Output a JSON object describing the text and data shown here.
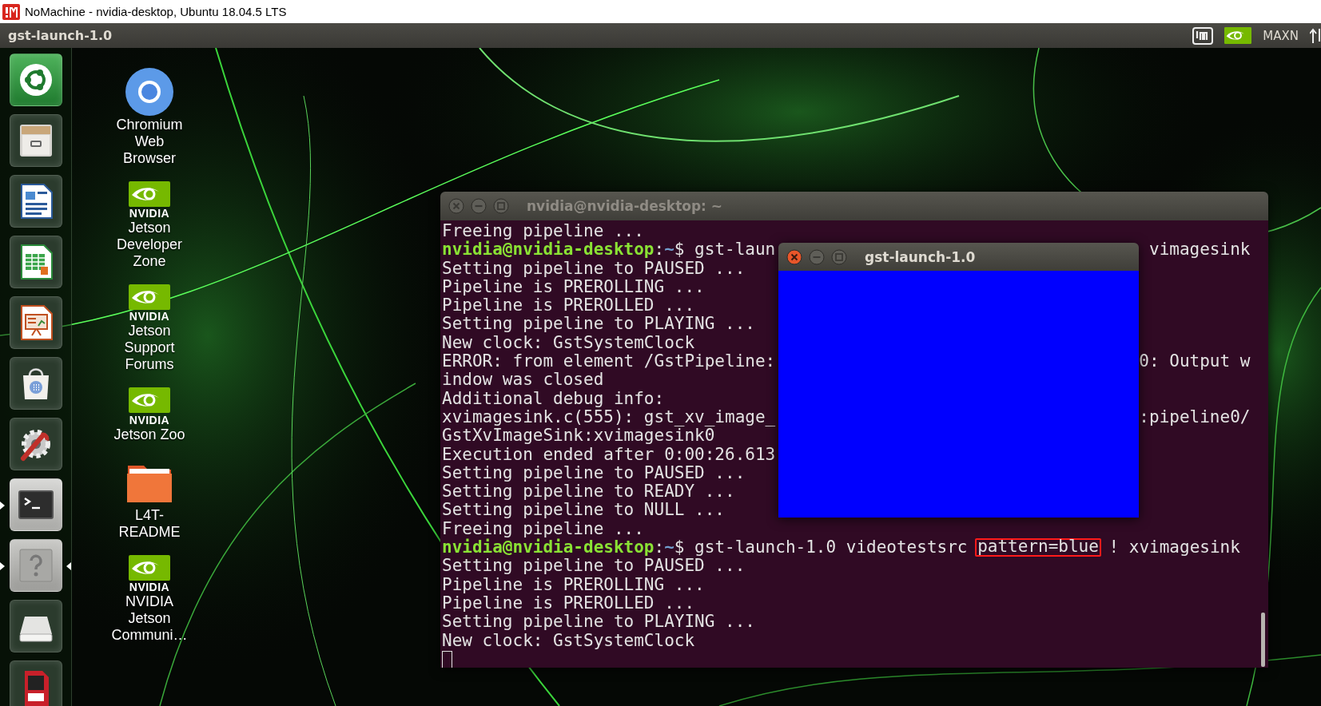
{
  "host_window": {
    "title": "NoMachine - nvidia-desktop, Ubuntu 18.04.5 LTS"
  },
  "top_panel": {
    "app_title": "gst-launch-1.0",
    "power_mode": "MAXN"
  },
  "launcher": {
    "items": [
      {
        "running": false,
        "focused": false
      },
      {
        "running": false,
        "focused": false
      },
      {
        "running": false,
        "focused": false
      },
      {
        "running": false,
        "focused": false
      },
      {
        "running": false,
        "focused": false
      },
      {
        "running": false,
        "focused": false
      },
      {
        "running": false,
        "focused": false
      },
      {
        "running": true,
        "focused": false
      },
      {
        "running": true,
        "focused": true
      },
      {
        "running": false,
        "focused": false
      },
      {
        "running": false,
        "focused": false
      }
    ]
  },
  "desktop_icons": [
    {
      "kind": "chromium",
      "label": "Chromium Web Browser"
    },
    {
      "kind": "nvidia",
      "wordmark": "NVIDIA",
      "label": "Jetson Developer Zone"
    },
    {
      "kind": "nvidia",
      "wordmark": "NVIDIA",
      "label": "Jetson Support Forums"
    },
    {
      "kind": "nvidia",
      "wordmark": "NVIDIA",
      "label": "Jetson Zoo"
    },
    {
      "kind": "folder",
      "label": "L4T-README"
    },
    {
      "kind": "nvidia",
      "wordmark": "NVIDIA",
      "label": "NVIDIA Jetson Communi…"
    }
  ],
  "terminal": {
    "title": "nvidia@nvidia-desktop: ~",
    "active": false,
    "lines": [
      {
        "kind": "text",
        "text": "Freeing pipeline ..."
      },
      {
        "kind": "command",
        "segments": [
          {
            "kind": "user",
            "text": "nvidia@nvidia-desktop"
          },
          {
            "kind": "plain",
            "text": ":"
          },
          {
            "kind": "path",
            "text": "~"
          },
          {
            "kind": "plain",
            "text": "$ gst-laun"
          }
        ],
        "right": "vimagesink"
      },
      {
        "kind": "text",
        "text": "Setting pipeline to PAUSED ..."
      },
      {
        "kind": "text",
        "text": "Pipeline is PREROLLING ..."
      },
      {
        "kind": "text",
        "text": "Pipeline is PREROLLED ..."
      },
      {
        "kind": "text",
        "text": "Setting pipeline to PLAYING ..."
      },
      {
        "kind": "text",
        "text": "New clock: GstSystemClock"
      },
      {
        "kind": "text",
        "text": "ERROR: from element /GstPipeline:",
        "right": "0: Output w"
      },
      {
        "kind": "text",
        "text": "indow was closed"
      },
      {
        "kind": "text",
        "text": "Additional debug info:"
      },
      {
        "kind": "text",
        "text": "xvimagesink.c(555): gst_xv_image_",
        "right": ":pipeline0/"
      },
      {
        "kind": "text",
        "text": "GstXvImageSink:xvimagesink0"
      },
      {
        "kind": "text",
        "text": "Execution ended after 0:00:26.613"
      },
      {
        "kind": "text",
        "text": "Setting pipeline to PAUSED ..."
      },
      {
        "kind": "text",
        "text": "Setting pipeline to READY ..."
      },
      {
        "kind": "text",
        "text": "Setting pipeline to NULL ..."
      },
      {
        "kind": "text",
        "text": "Freeing pipeline ..."
      },
      {
        "kind": "command",
        "segments": [
          {
            "kind": "user",
            "text": "nvidia@nvidia-desktop"
          },
          {
            "kind": "plain",
            "text": ":"
          },
          {
            "kind": "path",
            "text": "~"
          },
          {
            "kind": "plain",
            "text": "$ gst-launch-1.0 videotestsrc "
          },
          {
            "kind": "marked",
            "text": "pattern=blue"
          },
          {
            "kind": "plain",
            "text": " ! xvimagesink"
          }
        ]
      },
      {
        "kind": "text",
        "text": "Setting pipeline to PAUSED ..."
      },
      {
        "kind": "text",
        "text": "Pipeline is PREROLLING ..."
      },
      {
        "kind": "text",
        "text": "Pipeline is PREROLLED ..."
      },
      {
        "kind": "text",
        "text": "Setting pipeline to PLAYING ..."
      },
      {
        "kind": "text",
        "text": "New clock: GstSystemClock"
      },
      {
        "kind": "cursor"
      }
    ]
  },
  "video_window": {
    "title": "gst-launch-1.0",
    "active": true
  }
}
